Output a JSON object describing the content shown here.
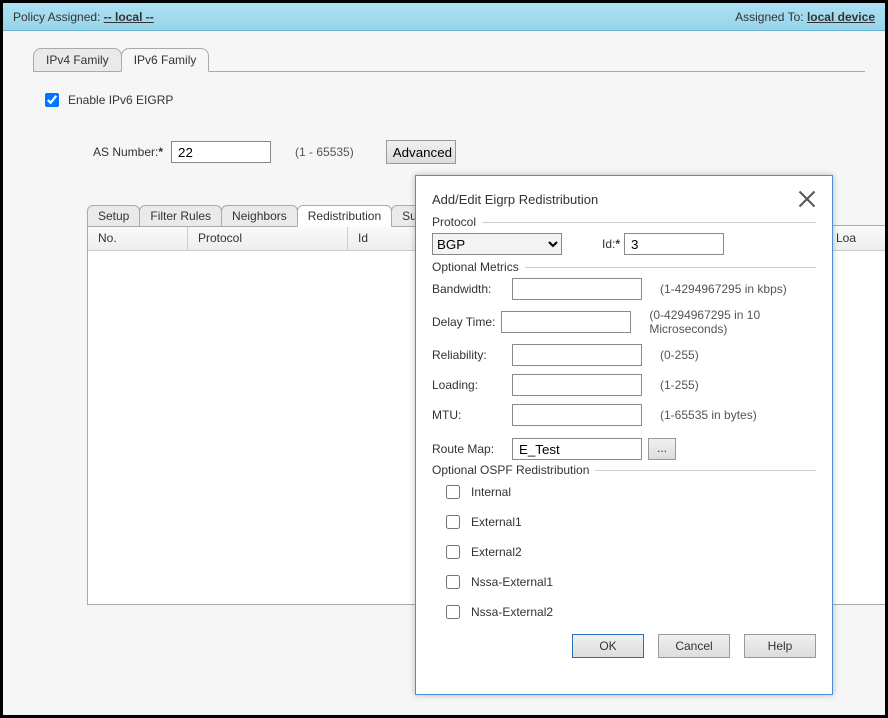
{
  "top": {
    "policy_assigned_label": "Policy Assigned:",
    "policy_assigned_value": "-- local --",
    "assigned_to_label": "Assigned To:",
    "assigned_to_value": "local device"
  },
  "tabs": {
    "ipv4": "IPv4 Family",
    "ipv6": "IPv6 Family"
  },
  "enable": {
    "label": "Enable IPv6 EIGRP",
    "checked": true
  },
  "as": {
    "label": "AS Number:",
    "required_mark": "*",
    "value": "22",
    "range": "(1 - 65535)",
    "advanced": "Advanced"
  },
  "inner_tabs": {
    "setup": "Setup",
    "filter": "Filter Rules",
    "neighbors": "Neighbors",
    "redistribution": "Redistribution",
    "summary": "Summary Ad"
  },
  "grid": {
    "no": "No.",
    "protocol": "Protocol",
    "id": "Id",
    "loa": "Loa"
  },
  "dialog": {
    "title": "Add/Edit Eigrp Redistribution",
    "protocol_legend": "Protocol",
    "protocol_value": "BGP",
    "id_label": "Id:",
    "id_required": "*",
    "id_value": "3",
    "metrics_legend": "Optional Metrics",
    "bandwidth_label": "Bandwidth:",
    "bandwidth_value": "",
    "bandwidth_hint": "(1-4294967295 in kbps)",
    "delay_label": "Delay Time:",
    "delay_value": "",
    "delay_hint": "(0-4294967295 in 10 Microseconds)",
    "reliability_label": "Reliability:",
    "reliability_value": "",
    "reliability_hint": "(0-255)",
    "loading_label": "Loading:",
    "loading_value": "",
    "loading_hint": "(1-255)",
    "mtu_label": "MTU:",
    "mtu_value": "",
    "mtu_hint": "(1-65535 in bytes)",
    "route_map_label": "Route Map:",
    "route_map_value": "E_Test",
    "browse": "...",
    "ospf_legend": "Optional OSPF Redistribution",
    "ospf": {
      "internal": "Internal",
      "external1": "External1",
      "external2": "External2",
      "nssa1": "Nssa-External1",
      "nssa2": "Nssa-External2"
    },
    "ok": "OK",
    "cancel": "Cancel",
    "help": "Help"
  }
}
